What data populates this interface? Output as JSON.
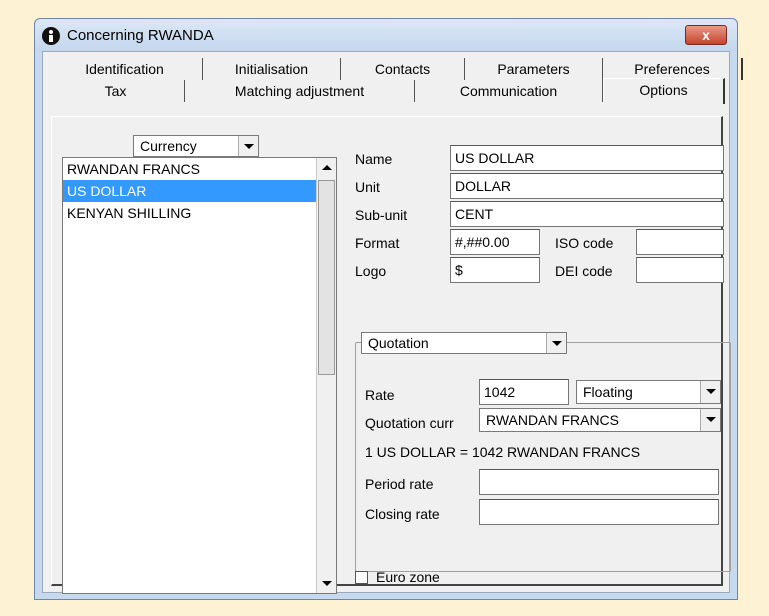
{
  "window": {
    "title": "Concerning RWANDA",
    "close_label": "x"
  },
  "tabs_row1": [
    "Identification",
    "Initialisation",
    "Contacts",
    "Parameters",
    "Preferences"
  ],
  "tabs_row2": [
    "Tax",
    "Matching adjustment",
    "Communication",
    "Options"
  ],
  "active_tab": "Options",
  "currency_combo": {
    "value": "Currency"
  },
  "currency_list": {
    "items": [
      "RWANDAN FRANCS",
      "US DOLLAR",
      "KENYAN SHILLING"
    ],
    "selected": "US DOLLAR"
  },
  "form": {
    "name_label": "Name",
    "name_value": "US DOLLAR",
    "unit_label": "Unit",
    "unit_value": "DOLLAR",
    "subunit_label": "Sub-unit",
    "subunit_value": "CENT",
    "format_label": "Format",
    "format_value": "#,##0.00",
    "iso_label": "ISO code",
    "iso_value": "",
    "logo_label": "Logo",
    "logo_value": "$",
    "dei_label": "DEI code",
    "dei_value": ""
  },
  "quotation": {
    "group_combo": "Quotation",
    "rate_label": "Rate",
    "rate_value": "1042",
    "rate_type": "Floating",
    "curr_label": "Quotation curr",
    "curr_value": "RWANDAN FRANCS",
    "conversion_text": "1 US DOLLAR = 1042 RWANDAN FRANCS",
    "period_label": "Period rate",
    "period_value": "",
    "closing_label": "Closing rate",
    "closing_value": ""
  },
  "euro_zone": {
    "label": "Euro zone",
    "checked": false
  }
}
